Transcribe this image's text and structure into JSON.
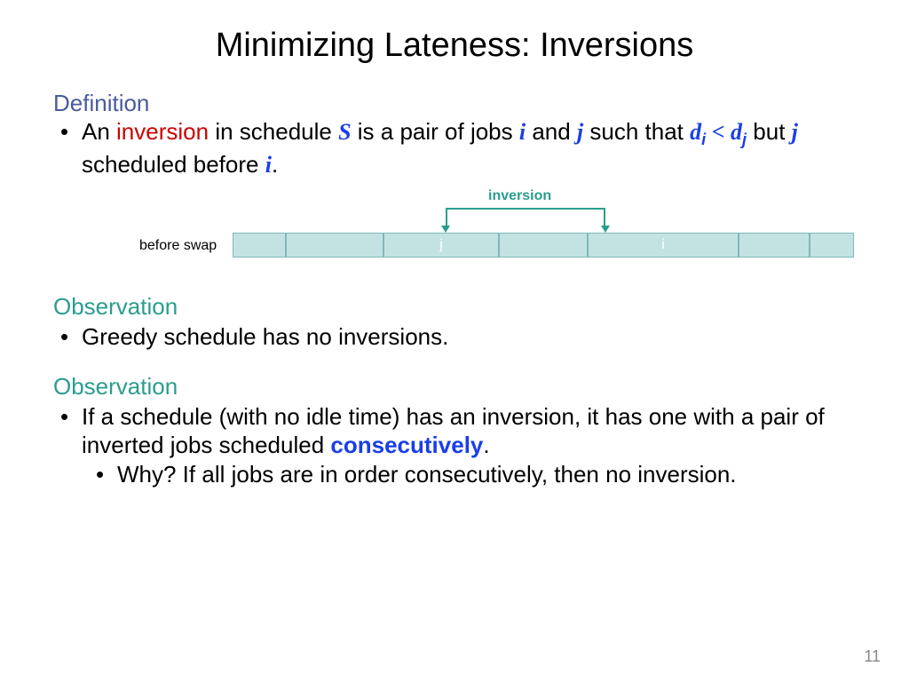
{
  "title": "Minimizing Lateness: Inversions",
  "definition": {
    "head": "Definition",
    "text_pre": "An ",
    "term": "inversion",
    "text_mid1": " in schedule ",
    "S": "S",
    "text_mid2": " is a pair of jobs ",
    "i": "i",
    "and": " and ",
    "j": "j",
    "such": " such that ",
    "di": "d",
    "di_sub": "i",
    "lt": " < ",
    "dj": "d",
    "dj_sub": "j",
    "but": " but ",
    "j2": "j",
    "sched": " scheduled before ",
    "i2": "i",
    "period": "."
  },
  "diagram": {
    "inversion_label": "inversion",
    "before_swap": "before swap",
    "seg_j": "j",
    "seg_i": "i",
    "widths": [
      60,
      110,
      130,
      100,
      170,
      80,
      50
    ]
  },
  "obs1": {
    "head": "Observation",
    "bullet": "Greedy schedule has no inversions."
  },
  "obs2": {
    "head": "Observation",
    "bullet_pre": "If a schedule (with no idle time) has an inversion, it has one with a pair of inverted jobs scheduled ",
    "consec": "consecutively",
    "bullet_post": ".",
    "sub": "Why? If all jobs are in order consecutively, then no inversion."
  },
  "page": "11"
}
